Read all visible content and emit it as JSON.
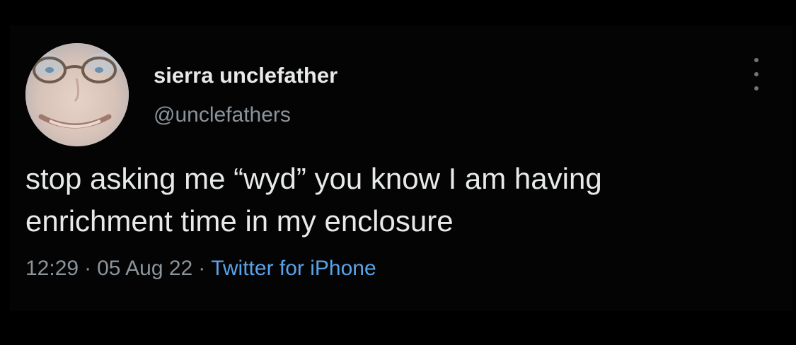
{
  "tweet": {
    "display_name": "sierra unclefather",
    "handle": "@unclefathers",
    "text": "stop asking me “wyd” you know I am having\nenrichment time in my enclosure",
    "time": "12:29",
    "date": "05 Aug 22",
    "source": "Twitter for iPhone",
    "separator": "·"
  },
  "icons": {
    "avatar": "profile-photo",
    "more": "more-vertical-icon"
  },
  "colors": {
    "background": "#000000",
    "text_primary": "#e7e9ea",
    "text_secondary": "#8b949b",
    "link": "#5aa3ea"
  }
}
